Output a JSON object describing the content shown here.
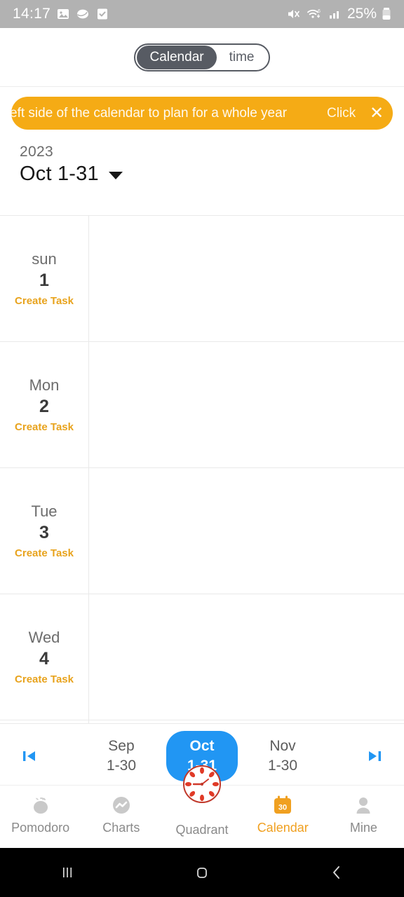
{
  "status_bar": {
    "time": "14:17",
    "battery_percent": "25%",
    "icons": [
      "gallery-icon",
      "cloud-icon",
      "task-check-icon",
      "mute-icon",
      "wifi-6-icon",
      "signal-bars-icon",
      "battery-icon"
    ]
  },
  "segment": {
    "items": [
      {
        "label": "Calendar",
        "active": true
      },
      {
        "label": "time",
        "active": false
      }
    ]
  },
  "banner": {
    "message": "eft side of the calendar to plan for a whole year",
    "cta": "Click",
    "close": "✕",
    "color": "#f5ab15"
  },
  "month_header": {
    "year": "2023",
    "range": "Oct 1-31"
  },
  "calendar": {
    "create_task_label": "Create Task",
    "days": [
      {
        "weekday": "sun",
        "date": "1"
      },
      {
        "weekday": "Mon",
        "date": "2"
      },
      {
        "weekday": "Tue",
        "date": "3"
      },
      {
        "weekday": "Wed",
        "date": "4"
      }
    ]
  },
  "pager": {
    "prev_icon": "skip-previous-icon",
    "next_icon": "skip-next-icon",
    "accent": "#2196f3",
    "months": [
      {
        "name": "Sep",
        "range": "1-30",
        "active": false
      },
      {
        "name": "Oct",
        "range": "1-31",
        "active": true
      },
      {
        "name": "Nov",
        "range": "1-30",
        "active": false
      }
    ]
  },
  "tabbar": {
    "active_color": "#f0a020",
    "items": [
      {
        "label": "Pomodoro",
        "icon": "tomato-icon",
        "active": false
      },
      {
        "label": "Charts",
        "icon": "chart-wave-icon",
        "active": false
      },
      {
        "label": "Quadrant",
        "icon": "tomato-clock-icon",
        "active": false
      },
      {
        "label": "Calendar",
        "icon": "calendar-30-icon",
        "active": true
      },
      {
        "label": "Mine",
        "icon": "person-icon",
        "active": false
      }
    ]
  },
  "android_nav": {
    "recents": "recents-icon",
    "home": "home-icon",
    "back": "back-icon"
  }
}
